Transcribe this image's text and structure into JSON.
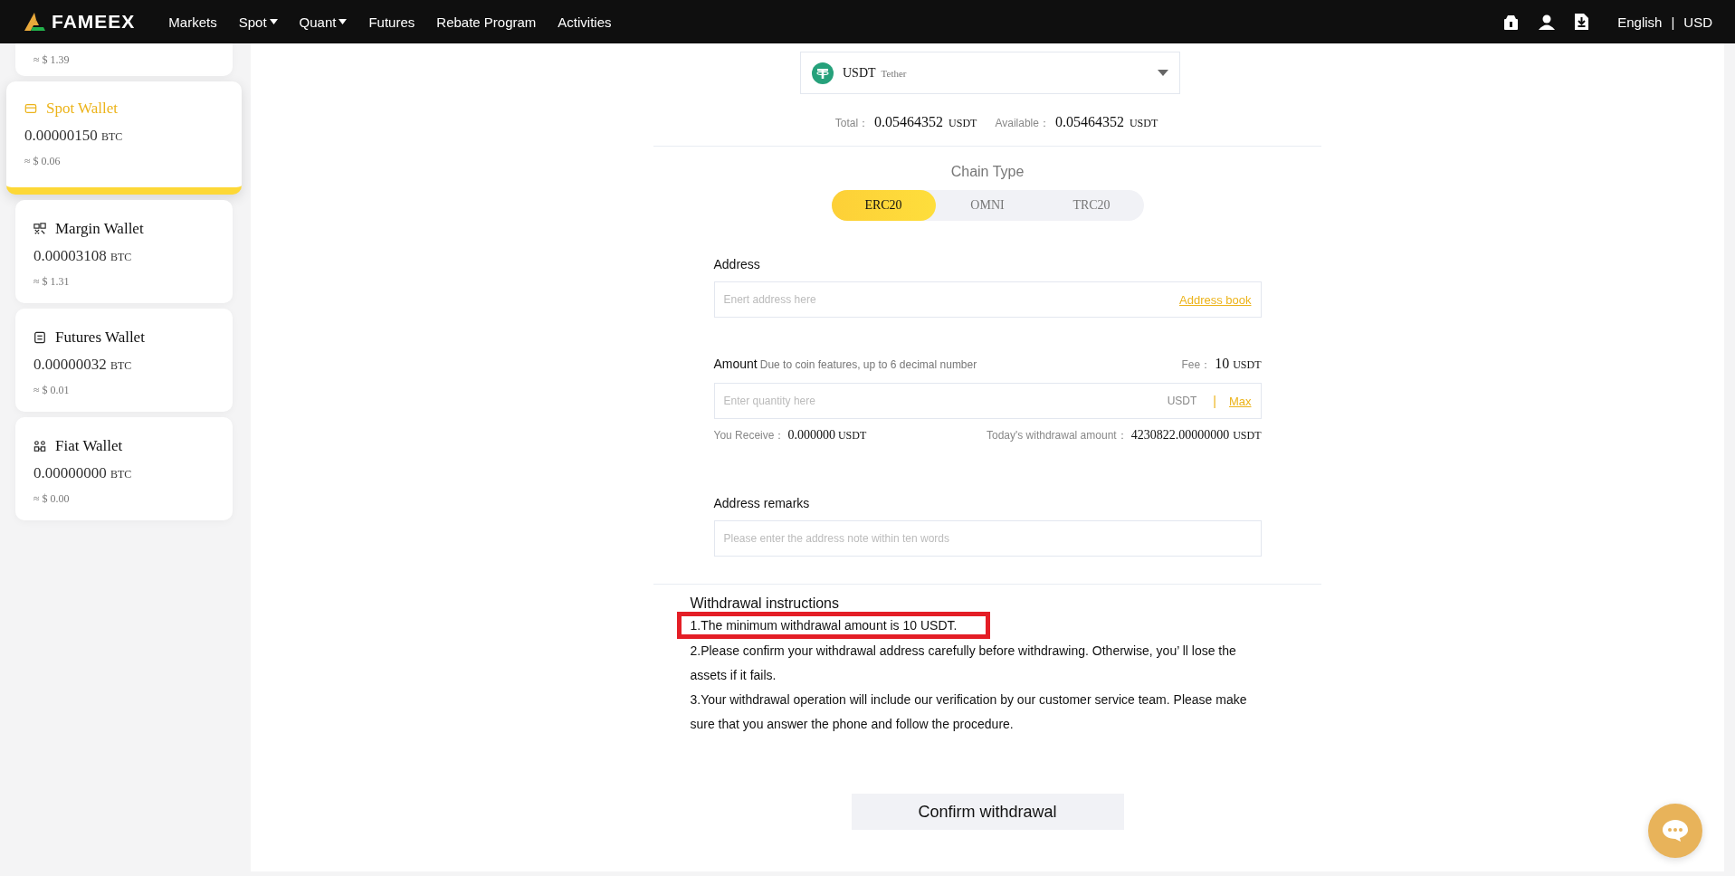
{
  "nav": {
    "logo": "FAMEEX",
    "items": [
      {
        "label": "Markets",
        "dropdown": false
      },
      {
        "label": "Spot",
        "dropdown": true
      },
      {
        "label": "Quant",
        "dropdown": true
      },
      {
        "label": "Futures",
        "dropdown": false
      },
      {
        "label": "Rebate Program",
        "dropdown": false
      },
      {
        "label": "Activities",
        "dropdown": false
      }
    ],
    "language": "English",
    "separator": "|",
    "currency": "USD"
  },
  "wallets": [
    {
      "kind": "cut",
      "usd": "≈ $ 1.39"
    },
    {
      "kind": "full",
      "name": "Spot Wallet",
      "amount": "0.00000150",
      "unit": "BTC",
      "usd": "≈ $ 0.06",
      "selected": true
    },
    {
      "kind": "full",
      "name": "Margin Wallet",
      "amount": "0.00003108",
      "unit": "BTC",
      "usd": "≈ $ 1.31",
      "selected": false
    },
    {
      "kind": "full",
      "name": "Futures Wallet",
      "amount": "0.00000032",
      "unit": "BTC",
      "usd": "≈ $ 0.01",
      "selected": false
    },
    {
      "kind": "full",
      "name": "Fiat Wallet",
      "amount": "0.00000000",
      "unit": "BTC",
      "usd": "≈ $ 0.00",
      "selected": false
    }
  ],
  "coin": {
    "symbol": "USDT",
    "name": "Tether"
  },
  "balance": {
    "total_label": "Total：",
    "total": "0.05464352",
    "total_unit": "USDT",
    "available_label": "Available：",
    "available": "0.05464352",
    "available_unit": "USDT"
  },
  "chain_type": {
    "title": "Chain Type",
    "options": [
      {
        "label": "ERC20",
        "selected": true
      },
      {
        "label": "OMNI",
        "selected": false
      },
      {
        "label": "TRC20",
        "selected": false
      }
    ]
  },
  "address": {
    "label": "Address",
    "placeholder": "Enert address here",
    "link": "Address book"
  },
  "amount": {
    "label": "Amount",
    "hint": "Due to coin features, up to 6 decimal number",
    "fee_label": "Fee：",
    "fee": "10",
    "fee_unit": "USDT",
    "placeholder": "Enter quantity here",
    "unit": "USDT",
    "separator": "|",
    "max": "Max",
    "receive_label": "You Receive：",
    "receive": "0.000000",
    "receive_unit": "USDT",
    "today_label": "Today's withdrawal amount：",
    "today": "4230822.00000000",
    "today_unit": "USDT"
  },
  "remarks": {
    "label": "Address remarks",
    "placeholder": "Please enter the address note within ten words"
  },
  "instructions": {
    "title": "Withdrawal instructions",
    "items": [
      {
        "text": "1.The minimum withdrawal amount is 10 USDT.",
        "highlighted": true
      },
      {
        "text": "2.Please confirm your withdrawal address carefully before withdrawing. Otherwise, you’ ll lose the assets if it fails.",
        "highlighted": false
      },
      {
        "text": "3.Your withdrawal operation will include our verification by our customer service team. Please make sure that you answer the phone and follow the procedure.",
        "highlighted": false
      }
    ]
  },
  "confirm": "Confirm withdrawal"
}
